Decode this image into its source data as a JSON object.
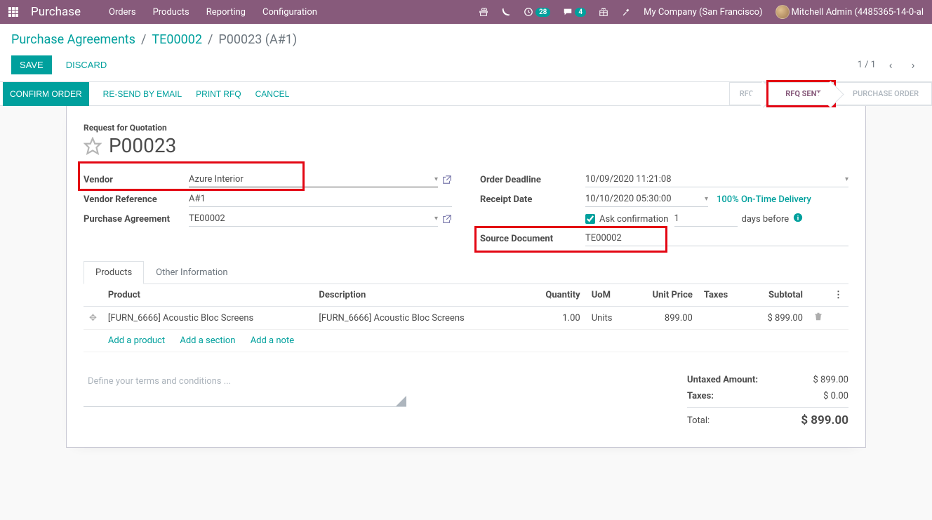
{
  "topnav": {
    "brand": "Purchase",
    "menu": [
      "Orders",
      "Products",
      "Reporting",
      "Configuration"
    ],
    "badge_call": "28",
    "badge_chat": "4",
    "company": "My Company (San Francisco)",
    "user": "Mitchell Admin (4485365-14-0-al"
  },
  "breadcrumb": {
    "root": "Purchase Agreements",
    "mid": "TE00002",
    "active": "P00023 (A#1)"
  },
  "mainbuttons": {
    "save": "Save",
    "discard": "Discard",
    "pager": "1 / 1"
  },
  "actionbar": {
    "confirm": "Confirm Order",
    "resend": "Re-send by Email",
    "print": "Print RFQ",
    "cancel": "Cancel"
  },
  "statusbar": {
    "rfq": "RFQ",
    "rfq_sent": "RFQ Sent",
    "po": "Purchase Order"
  },
  "title": {
    "label": "Request for Quotation",
    "name": "P00023"
  },
  "fields": {
    "vendor_label": "Vendor",
    "vendor_value": "Azure Interior",
    "vendor_ref_label": "Vendor Reference",
    "vendor_ref_value": "A#1",
    "pa_label": "Purchase Agreement",
    "pa_value": "TE00002",
    "deadline_label": "Order Deadline",
    "deadline_value": "10/09/2020 11:21:08",
    "receipt_label": "Receipt Date",
    "receipt_value": "10/10/2020 05:30:00",
    "receipt_link": "100% On-Time Delivery",
    "ask_conf_label": "Ask confirmation",
    "ask_conf_days": "1",
    "days_before": "days before",
    "source_label": "Source Document",
    "source_value": "TE00002"
  },
  "tabs": {
    "products": "Products",
    "other": "Other Information"
  },
  "table": {
    "head": {
      "product": "Product",
      "desc": "Description",
      "qty": "Quantity",
      "uom": "UoM",
      "price": "Unit Price",
      "taxes": "Taxes",
      "subtotal": "Subtotal"
    },
    "row": {
      "product": "[FURN_6666] Acoustic Bloc Screens",
      "desc": "[FURN_6666] Acoustic Bloc Screens",
      "qty": "1.00",
      "uom": "Units",
      "price": "899.00",
      "taxes": "",
      "subtotal": "$ 899.00"
    },
    "add_product": "Add a product",
    "add_section": "Add a section",
    "add_note": "Add a note"
  },
  "terms_placeholder": "Define your terms and conditions ...",
  "totals": {
    "untaxed_label": "Untaxed Amount:",
    "untaxed_value": "$ 899.00",
    "taxes_label": "Taxes:",
    "taxes_value": "$ 0.00",
    "total_label": "Total:",
    "total_value": "$ 899.00"
  }
}
